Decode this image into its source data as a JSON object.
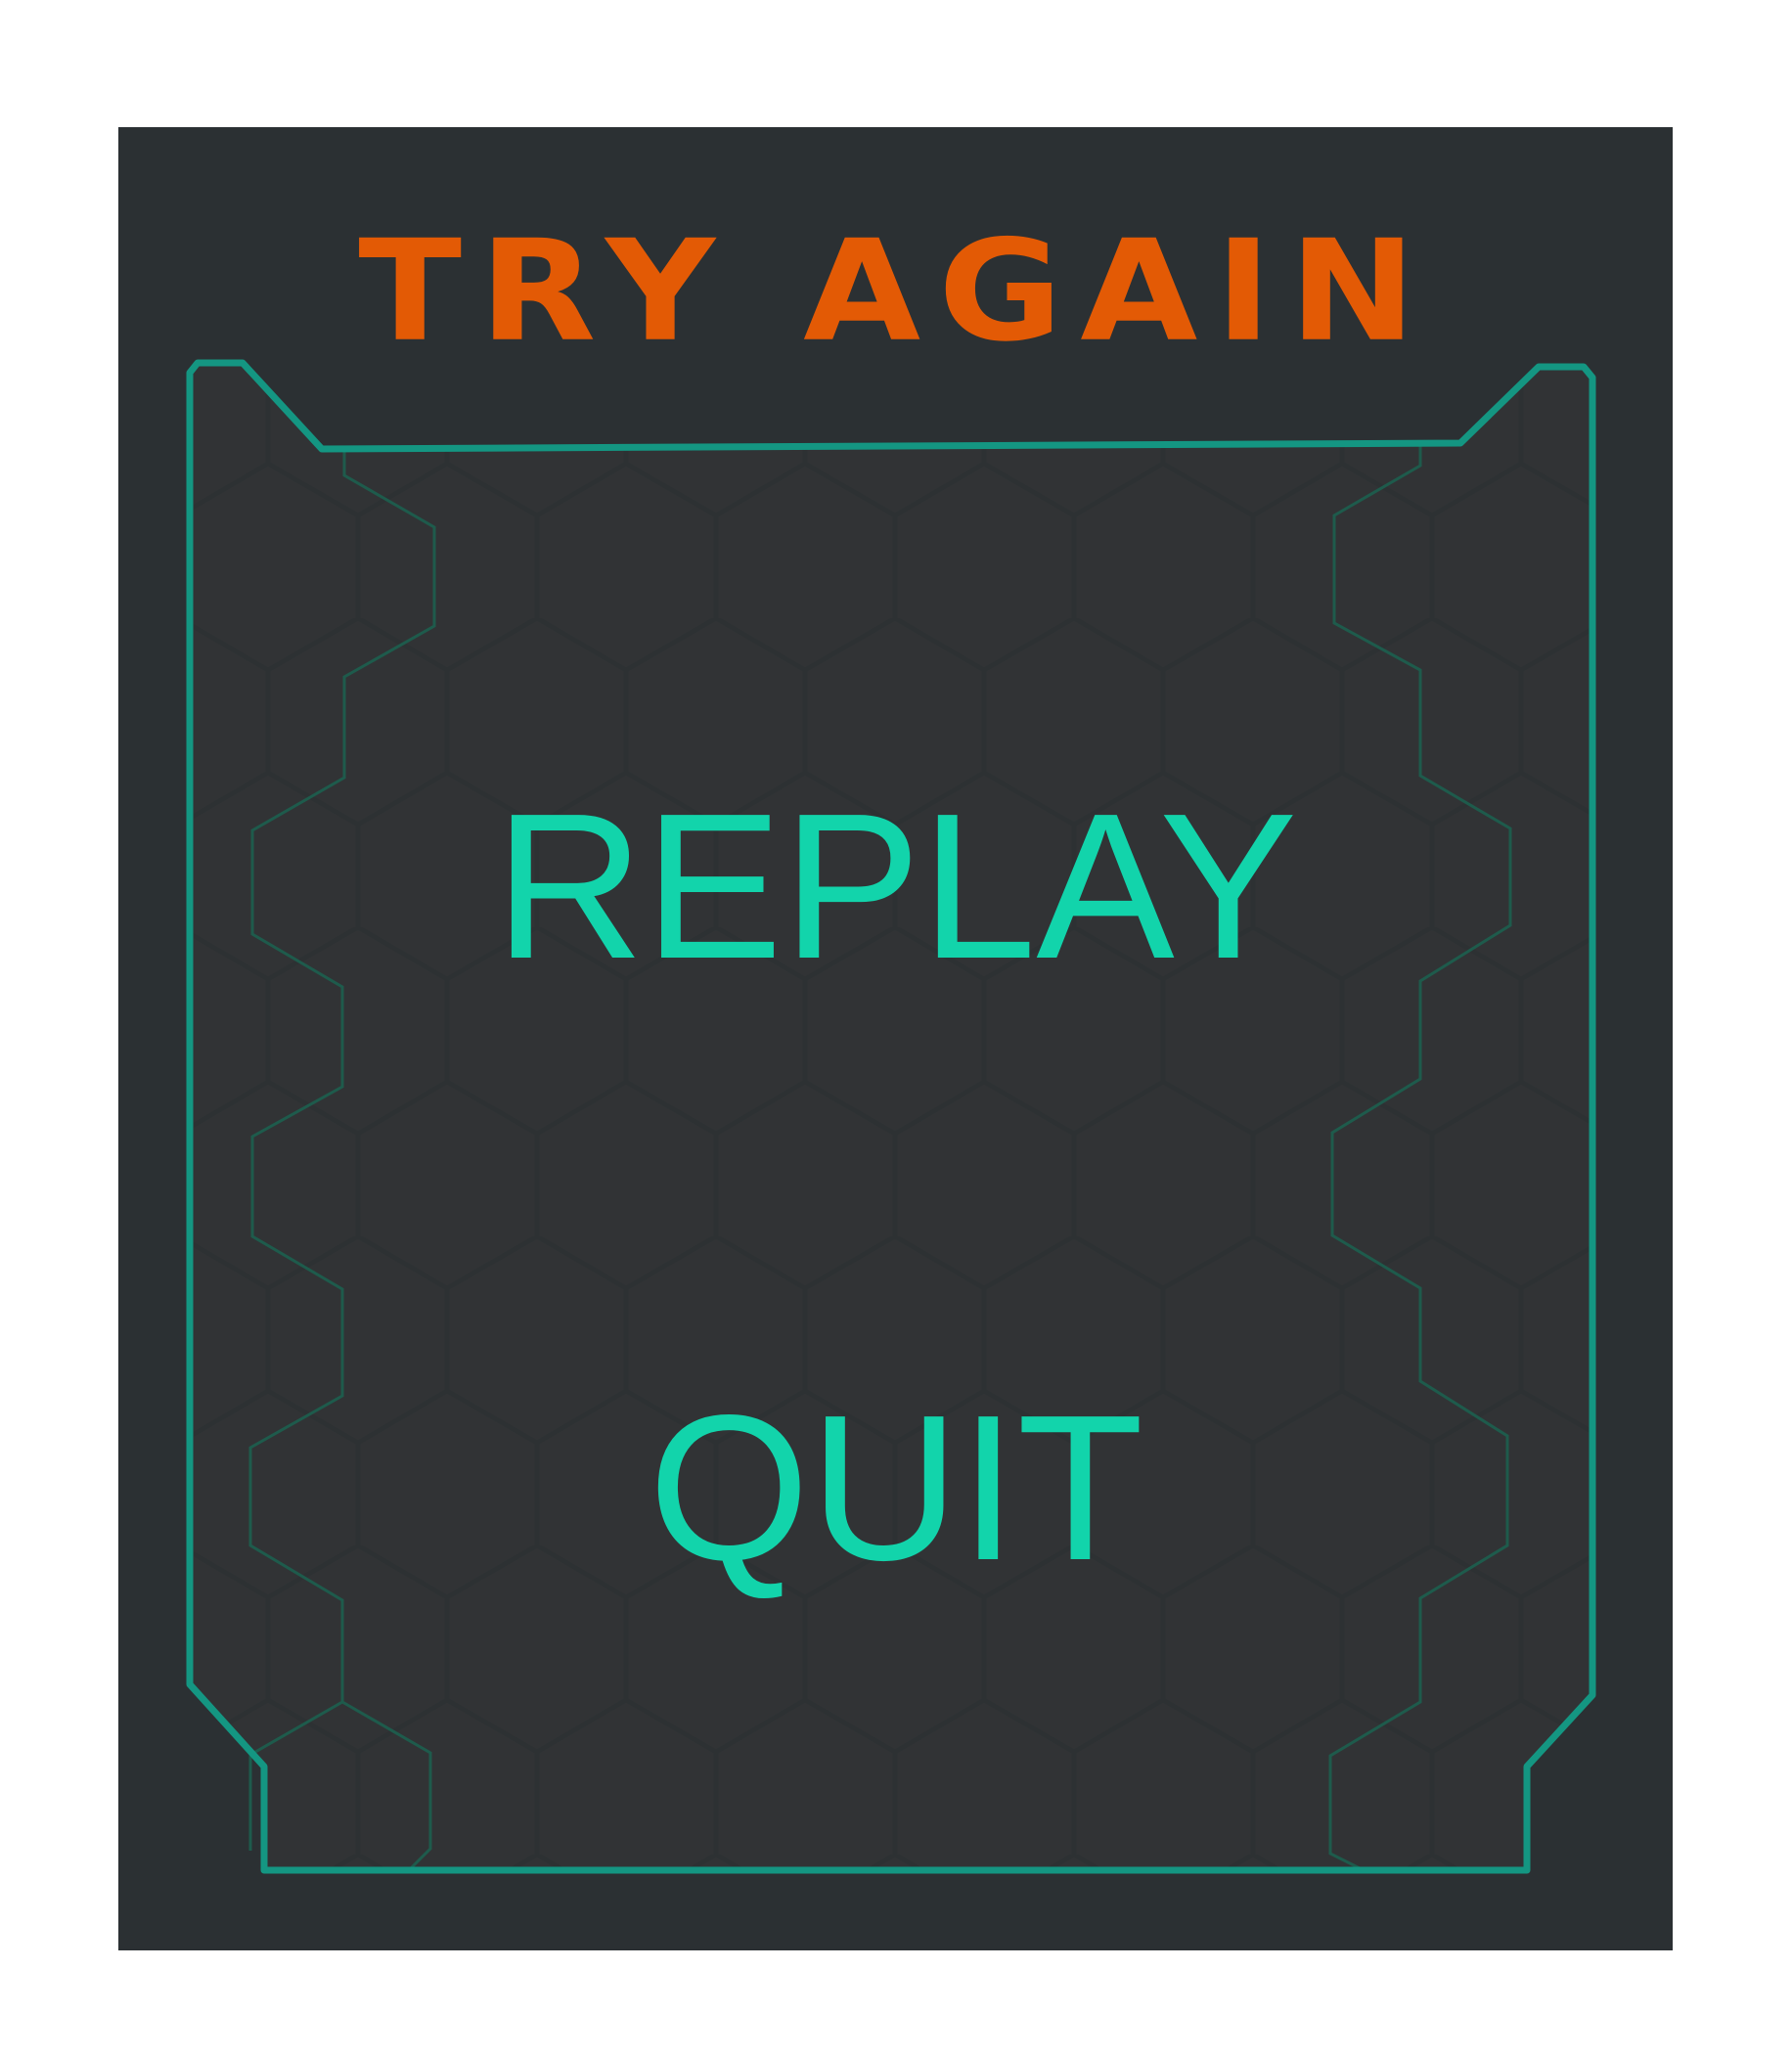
{
  "dialog": {
    "title": "TRY AGAIN",
    "buttons": {
      "replay": "REPLAY",
      "quit": "QUIT"
    }
  },
  "colors": {
    "panel_background": "#2b3033",
    "inner_background": "#313335",
    "title": "#e35a05",
    "button_text": "#12d4ab",
    "frame_border": "#149682",
    "hex_grid": "#1e5b4c"
  }
}
